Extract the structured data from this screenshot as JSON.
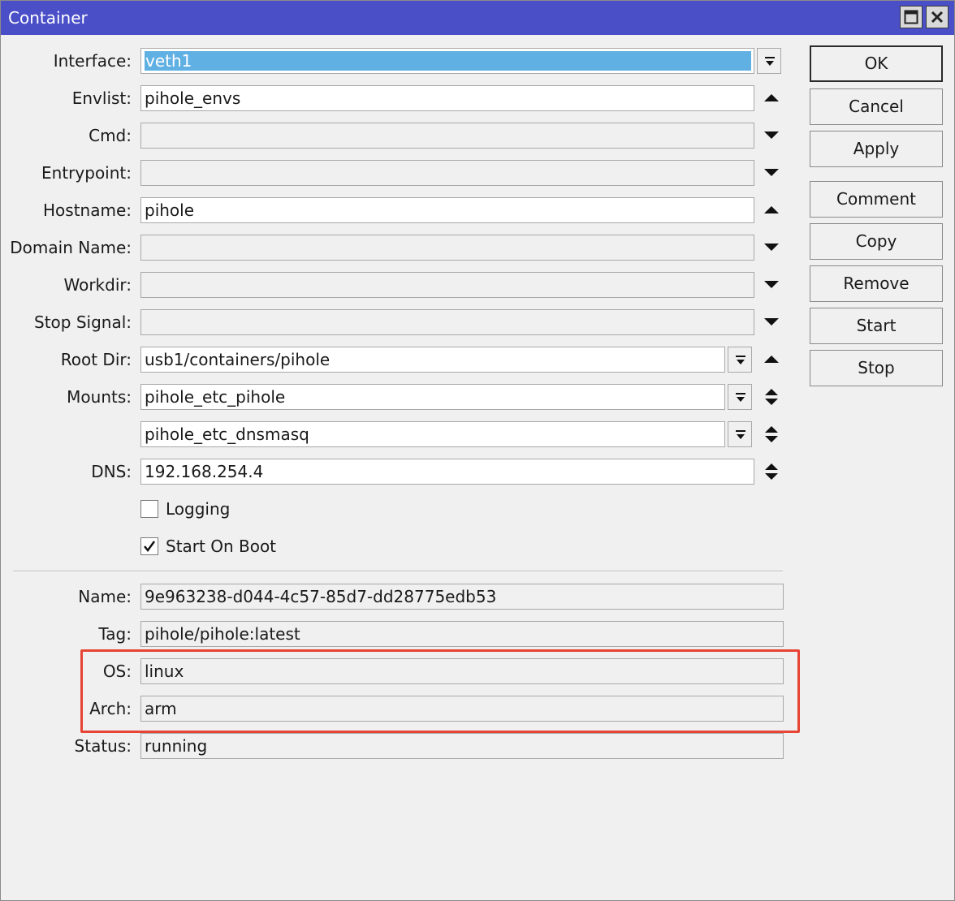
{
  "window": {
    "title": "Container"
  },
  "form": {
    "interface": {
      "label": "Interface:",
      "value": "veth1"
    },
    "envlist": {
      "label": "Envlist:",
      "value": "pihole_envs"
    },
    "cmd": {
      "label": "Cmd:",
      "value": ""
    },
    "entrypoint": {
      "label": "Entrypoint:",
      "value": ""
    },
    "hostname": {
      "label": "Hostname:",
      "value": "pihole"
    },
    "domain_name": {
      "label": "Domain Name:",
      "value": ""
    },
    "workdir": {
      "label": "Workdir:",
      "value": ""
    },
    "stop_signal": {
      "label": "Stop Signal:",
      "value": ""
    },
    "root_dir": {
      "label": "Root Dir:",
      "value": "usb1/containers/pihole"
    },
    "mounts": {
      "label": "Mounts:",
      "values": [
        "pihole_etc_pihole",
        "pihole_etc_dnsmasq"
      ]
    },
    "dns": {
      "label": "DNS:",
      "value": "192.168.254.4"
    },
    "logging": {
      "label": "Logging",
      "checked": false
    },
    "start_on_boot": {
      "label": "Start On Boot",
      "checked": true
    }
  },
  "info": {
    "name": {
      "label": "Name:",
      "value": "9e963238-d044-4c57-85d7-dd28775edb53"
    },
    "tag": {
      "label": "Tag:",
      "value": "pihole/pihole:latest"
    },
    "os": {
      "label": "OS:",
      "value": "linux"
    },
    "arch": {
      "label": "Arch:",
      "value": "arm"
    },
    "status": {
      "label": "Status:",
      "value": "running"
    }
  },
  "buttons": {
    "ok": "OK",
    "cancel": "Cancel",
    "apply": "Apply",
    "comment": "Comment",
    "copy": "Copy",
    "remove": "Remove",
    "start": "Start",
    "stop": "Stop"
  },
  "colors": {
    "titlebar": "#4a4fc8",
    "selection": "#60b0e4",
    "highlight_box": "#e64434"
  },
  "icons": {
    "window_buttons": [
      "maximize-icon",
      "close-icon"
    ],
    "field_controls": [
      "dropdown-icon",
      "triangle-up-icon",
      "triangle-down-icon",
      "up-down-icon"
    ]
  }
}
